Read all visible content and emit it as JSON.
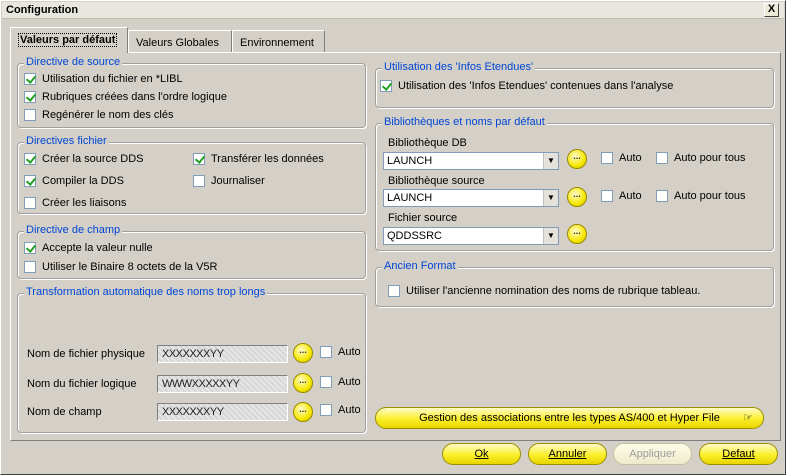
{
  "window": {
    "title": "Configuration",
    "close_label": "X"
  },
  "tabs": [
    {
      "label": "Valeurs par défaut",
      "active": true
    },
    {
      "label": "Valeurs Globales",
      "active": false
    },
    {
      "label": "Environnement",
      "active": false
    }
  ],
  "source": {
    "title": "Directive de source",
    "items": [
      {
        "label": "Utilisation du fichier en *LIBL",
        "checked": true
      },
      {
        "label": "Rubriques créées dans l'ordre logique",
        "checked": true
      },
      {
        "label": "Regénérer le nom des clés",
        "checked": false
      }
    ]
  },
  "fichier": {
    "title": "Directives fichier",
    "items": [
      {
        "label": "Créer la source DDS",
        "checked": true
      },
      {
        "label": "Transférer les données",
        "checked": true
      },
      {
        "label": "Compiler la DDS",
        "checked": true
      },
      {
        "label": "Journaliser",
        "checked": false
      },
      {
        "label": "Créer les liaisons",
        "checked": false
      }
    ]
  },
  "champ": {
    "title": "Directive de champ",
    "items": [
      {
        "label": "Accepte la valeur nulle",
        "checked": true
      },
      {
        "label": "Utiliser le Binaire 8 octets de la V5R",
        "checked": false
      }
    ]
  },
  "transfo": {
    "title": "Transformation automatique des noms trop longs",
    "rows": [
      {
        "label": "Nom de fichier physique",
        "value": "XXXXXXXYY",
        "auto_label": "Auto",
        "auto": false
      },
      {
        "label": "Nom du fichier logique",
        "value": "WWWXXXXXYY",
        "auto_label": "Auto",
        "auto": false
      },
      {
        "label": "Nom de champ",
        "value": "XXXXXXXYY",
        "auto_label": "Auto",
        "auto": false
      }
    ]
  },
  "infos": {
    "title": "Utilisation des 'Infos Etendues'",
    "item": {
      "label": "Utilisation des 'Infos Etendues' contenues dans l'analyse",
      "checked": true
    }
  },
  "biblio": {
    "title": "Bibliothèques et noms par défaut",
    "rows": [
      {
        "label": "Bibliothèque DB",
        "value": "LAUNCH",
        "auto_label": "Auto",
        "auto_tous_label": "Auto pour tous"
      },
      {
        "label": "Bibliothèque source",
        "value": "LAUNCH",
        "auto_label": "Auto",
        "auto_tous_label": "Auto pour tous"
      },
      {
        "label": "Fichier source",
        "value": "QDDSSRC"
      }
    ],
    "ellipsis": "..."
  },
  "ancien": {
    "title": "Ancien Format",
    "item": {
      "label": "Utiliser l'ancienne nomination des noms de rubrique tableau.",
      "checked": false
    }
  },
  "gestion_label": "Gestion des associations entre les types AS/400 et Hyper File",
  "buttons": {
    "ok": "Ok",
    "annuler": "Annuler",
    "appliquer": "Appliquer",
    "defaut": "Defaut"
  }
}
